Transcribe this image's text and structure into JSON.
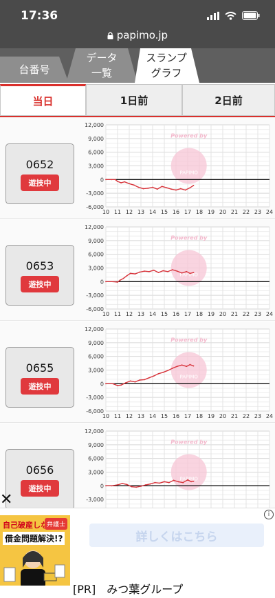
{
  "status_bar": {
    "time": "17:36"
  },
  "browser": {
    "url": "papimo.jp"
  },
  "top_tabs": [
    "台番号",
    "データ\n一覧",
    "スランプ\nグラフ"
  ],
  "day_tabs": [
    "当日",
    "1日前",
    "2日前"
  ],
  "chart_axis": {
    "y_ticks": [
      "12,000",
      "9,000",
      "6,000",
      "3,000",
      "0",
      "-3,000",
      "-6,000"
    ],
    "x_ticks": [
      "10",
      "11",
      "12",
      "13",
      "14",
      "15",
      "16",
      "17",
      "18",
      "19",
      "20",
      "21",
      "22",
      "23",
      "24"
    ],
    "watermark": "Powered by",
    "watermark_brand": "PAPIMO"
  },
  "machines": [
    {
      "number": "0652",
      "status": "遊技中"
    },
    {
      "number": "0653",
      "status": "遊技中"
    },
    {
      "number": "0655",
      "status": "遊技中"
    },
    {
      "number": "0656",
      "status": "遊技中"
    }
  ],
  "chart_data": [
    {
      "type": "line",
      "title": "0652",
      "ylim": [
        -6000,
        12000
      ],
      "xlim": [
        10,
        24
      ],
      "x": [
        10,
        10.5,
        10.8,
        11,
        11.3,
        11.6,
        12,
        12.4,
        12.8,
        13.2,
        13.6,
        14,
        14.4,
        14.8,
        15.2,
        15.6,
        16,
        16.4,
        16.8,
        17.2,
        17.5
      ],
      "values": [
        0,
        0,
        0,
        -400,
        -700,
        -500,
        -900,
        -1200,
        -1700,
        -2000,
        -1900,
        -1700,
        -2100,
        -1500,
        -1800,
        -2100,
        -2300,
        -2000,
        -2300,
        -1800,
        -1300
      ]
    },
    {
      "type": "line",
      "title": "0653",
      "ylim": [
        -6000,
        12000
      ],
      "xlim": [
        10,
        24
      ],
      "x": [
        10,
        10.6,
        11,
        11.2,
        11.5,
        11.8,
        12.1,
        12.5,
        12.9,
        13.3,
        13.7,
        14.1,
        14.5,
        14.9,
        15.3,
        15.7,
        16.1,
        16.5,
        16.9,
        17.2,
        17.5
      ],
      "values": [
        0,
        0,
        -100,
        300,
        700,
        1300,
        1800,
        1700,
        2100,
        2300,
        2200,
        2500,
        2000,
        2400,
        2200,
        2600,
        2300,
        1900,
        2200,
        1800,
        2000
      ]
    },
    {
      "type": "line",
      "title": "0655",
      "ylim": [
        -6000,
        12000
      ],
      "xlim": [
        10,
        24
      ],
      "x": [
        10,
        10.6,
        11,
        11.3,
        11.7,
        12.1,
        12.5,
        12.9,
        13.3,
        13.7,
        14.1,
        14.5,
        14.9,
        15.3,
        15.7,
        16.1,
        16.5,
        16.9,
        17.2,
        17.5
      ],
      "values": [
        0,
        0,
        -400,
        -300,
        200,
        600,
        400,
        800,
        900,
        1300,
        1700,
        2200,
        2500,
        2900,
        3400,
        3800,
        4100,
        3800,
        4200,
        3900
      ]
    },
    {
      "type": "line",
      "title": "0656",
      "ylim": [
        -6000,
        12000
      ],
      "xlim": [
        10,
        24
      ],
      "x": [
        10,
        10.5,
        11,
        11.4,
        11.8,
        12.2,
        12.6,
        13,
        13.4,
        13.8,
        14.2,
        14.6,
        15,
        15.4,
        15.8,
        16.2,
        16.6,
        17,
        17.3,
        17.5
      ],
      "values": [
        0,
        0,
        200,
        500,
        300,
        -200,
        -300,
        -100,
        200,
        400,
        700,
        600,
        900,
        700,
        1200,
        900,
        700,
        1300,
        900,
        1000
      ]
    }
  ],
  "ad": {
    "image_text_1": "自己破産しなくても",
    "image_text_2": "借金問題解決!?",
    "image_badge": "弁護士",
    "button_label": "詳しくはこちら",
    "sponsor": "[PR]　みつ葉グループ",
    "close_glyph": "✕",
    "info_glyph": "i"
  }
}
